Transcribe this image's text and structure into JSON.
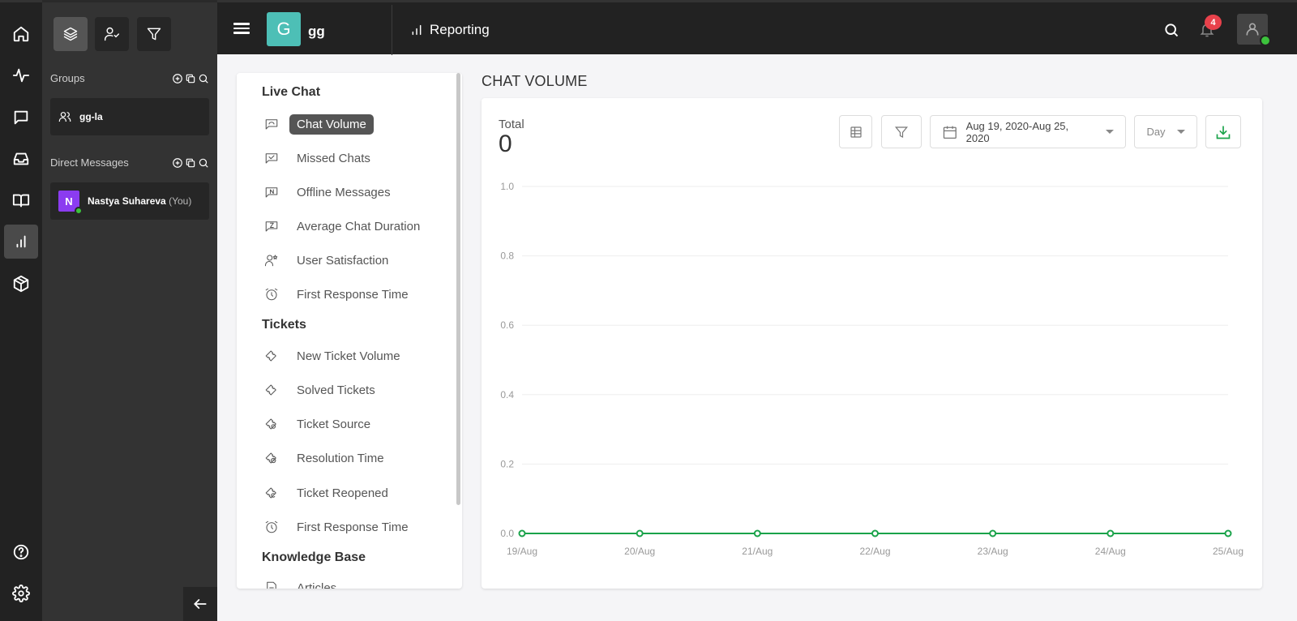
{
  "rail": {
    "items": [
      {
        "name": "home",
        "icon": "home-icon",
        "active": false
      },
      {
        "name": "activity",
        "icon": "activity-icon",
        "active": false
      },
      {
        "name": "chat",
        "icon": "chat-icon",
        "active": false
      },
      {
        "name": "inbox",
        "icon": "inbox-icon",
        "active": false
      },
      {
        "name": "knowledge-base",
        "icon": "book-icon",
        "active": false
      },
      {
        "name": "reporting",
        "icon": "bar-chart-icon",
        "active": true
      },
      {
        "name": "packages",
        "icon": "box-icon",
        "active": false
      }
    ],
    "bottom": [
      {
        "name": "help",
        "icon": "help-icon"
      },
      {
        "name": "settings",
        "icon": "gear-icon"
      }
    ]
  },
  "panel": {
    "tabs": [
      {
        "name": "layers",
        "icon": "layers-icon",
        "active": true
      },
      {
        "name": "assigned",
        "icon": "user-check-icon",
        "active": false
      },
      {
        "name": "filter",
        "icon": "filter-icon",
        "active": false
      }
    ],
    "groups_label": "Groups",
    "groups": [
      {
        "label": "gg-la",
        "icon": "users-icon"
      }
    ],
    "dm_label": "Direct Messages",
    "direct_messages": [
      {
        "initial": "N",
        "name": "Nastya Suhareva",
        "suffix": "(You)",
        "online": true
      }
    ],
    "collapse_icon": "arrow-left-icon"
  },
  "topbar": {
    "workspace_initial": "G",
    "workspace_name": "gg",
    "section_title": "Reporting",
    "notifications_count": "4",
    "colors": {
      "workspace": "#4dbfb6",
      "badge": "#e8414b",
      "online": "#3cc23c"
    }
  },
  "menu": {
    "sections": [
      {
        "title": "Live Chat",
        "items": [
          {
            "label": "Chat Volume",
            "icon": "chat-volume-icon",
            "active": true
          },
          {
            "label": "Missed Chats",
            "icon": "missed-chats-icon",
            "active": false
          },
          {
            "label": "Offline Messages",
            "icon": "offline-messages-icon",
            "active": false
          },
          {
            "label": "Average Chat Duration",
            "icon": "hourglass-chat-icon",
            "active": false
          },
          {
            "label": "User Satisfaction",
            "icon": "user-star-icon",
            "active": false
          },
          {
            "label": "First Response Time",
            "icon": "alarm-clock-icon",
            "active": false
          }
        ]
      },
      {
        "title": "Tickets",
        "items": [
          {
            "label": "New Ticket Volume",
            "icon": "ticket-new-icon",
            "active": false
          },
          {
            "label": "Solved Tickets",
            "icon": "ticket-solved-icon",
            "active": false
          },
          {
            "label": "Ticket Source",
            "icon": "ticket-source-icon",
            "active": false
          },
          {
            "label": "Resolution Time",
            "icon": "ticket-clock-icon",
            "active": false
          },
          {
            "label": "Ticket Reopened",
            "icon": "ticket-reopen-icon",
            "active": false
          },
          {
            "label": "First Response Time",
            "icon": "alarm-clock-icon",
            "active": false
          }
        ]
      },
      {
        "title": "Knowledge Base",
        "items": [
          {
            "label": "Articles",
            "icon": "article-icon",
            "active": false
          }
        ]
      }
    ]
  },
  "report": {
    "title": "CHAT VOLUME",
    "total_label": "Total",
    "total_value": "0",
    "date_range": "Aug 19, 2020-Aug 25, 2020",
    "granularity": "Day",
    "accent_color": "#1aa34a"
  },
  "chart_data": {
    "type": "line",
    "title": "",
    "xlabel": "",
    "ylabel": "",
    "categories": [
      "19/Aug",
      "20/Aug",
      "21/Aug",
      "22/Aug",
      "23/Aug",
      "24/Aug",
      "25/Aug"
    ],
    "series": [
      {
        "name": "Chat Volume",
        "values": [
          0,
          0,
          0,
          0,
          0,
          0,
          0
        ],
        "color": "#1aa34a"
      }
    ],
    "ylim": [
      0,
      1.0
    ],
    "yticks": [
      "0.0",
      "0.2",
      "0.4",
      "0.6",
      "0.8",
      "1.0"
    ],
    "grid": true,
    "legend": "none"
  }
}
